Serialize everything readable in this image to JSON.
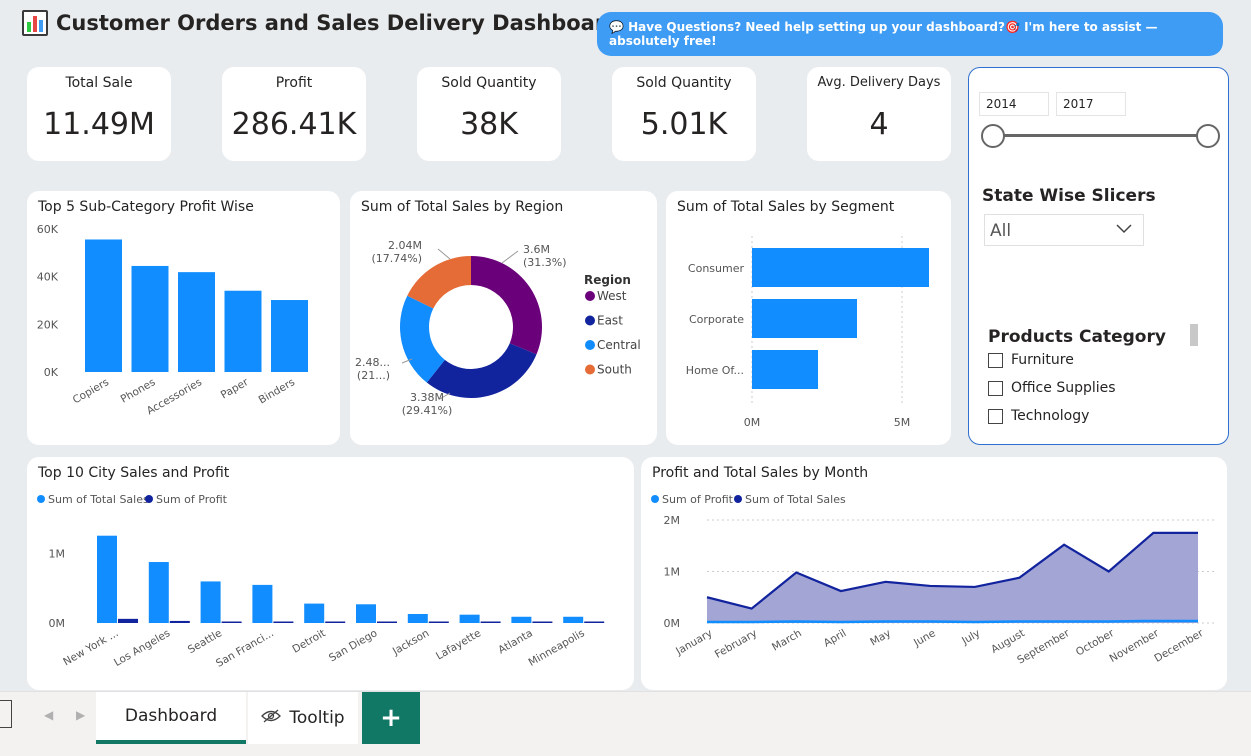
{
  "header": {
    "title": "Customer Orders and Sales Delivery Dashboard",
    "help_text": "💬 Have Questions? Need help setting up your dashboard?🎯 I'm here to assist — absolutely free!"
  },
  "kpis": [
    {
      "label": "Total Sale",
      "value": "11.49M"
    },
    {
      "label": "Profit",
      "value": "286.41K"
    },
    {
      "label": "Sold Quantity",
      "value": "38K"
    },
    {
      "label": "Sold Quantity",
      "value": "5.01K"
    },
    {
      "label": "Avg. Delivery Days",
      "value": "4"
    }
  ],
  "filters": {
    "date_from": "2014",
    "date_to": "2017",
    "state_heading": "State Wise Slicers",
    "state_value": "All",
    "category_heading": "Products Category",
    "categories": [
      "Furniture",
      "Office Supplies",
      "Technology"
    ]
  },
  "colors": {
    "blue": "#118dff",
    "dark_blue": "#12239e",
    "purple": "#6b007b",
    "orange": "#e66c37",
    "area_fill": "#a3a6d4"
  },
  "chart_data": [
    {
      "id": "subcat",
      "type": "bar",
      "title": "Top 5 Sub-Category Profit Wise",
      "categories": [
        "Copiers",
        "Phones",
        "Accessories",
        "Paper",
        "Binders"
      ],
      "values": [
        55600,
        44500,
        41900,
        34100,
        30200
      ],
      "yticks": [
        "0K",
        "20K",
        "40K",
        "60K"
      ],
      "ylim": [
        0,
        60000
      ]
    },
    {
      "id": "region",
      "type": "pie",
      "title": "Sum of Total Sales by Region",
      "legend_title": "Region",
      "slices": [
        {
          "name": "West",
          "value": 3.6,
          "label": "3.6M",
          "pct": "(31.3%)",
          "color": "#6b007b"
        },
        {
          "name": "East",
          "value": 3.38,
          "label": "3.38M",
          "pct": "(29.41%)",
          "color": "#12239e"
        },
        {
          "name": "Central",
          "value": 2.48,
          "label": "2.48...",
          "pct": "(21...)",
          "color": "#118dff"
        },
        {
          "name": "South",
          "value": 2.04,
          "label": "2.04M",
          "pct": "(17.74%)",
          "color": "#e66c37"
        }
      ]
    },
    {
      "id": "segment",
      "type": "bar",
      "orientation": "horizontal",
      "title": "Sum of Total Sales by Segment",
      "categories": [
        "Consumer",
        "Corporate",
        "Home Of..."
      ],
      "values": [
        5.9,
        3.5,
        2.2
      ],
      "xticks": [
        "0M",
        "5M"
      ],
      "xlim": [
        0,
        5
      ]
    },
    {
      "id": "city",
      "type": "bar",
      "title": "Top 10 City Sales and Profit",
      "categories": [
        "New York ...",
        "Los Angeles",
        "Seattle",
        "San Franci...",
        "Detroit",
        "San Diego",
        "Jackson",
        "Lafayette",
        "Atlanta",
        "Minneapolis"
      ],
      "series": [
        {
          "name": "Sum of Total Sales",
          "values": [
            1.26,
            0.88,
            0.6,
            0.55,
            0.28,
            0.27,
            0.13,
            0.12,
            0.09,
            0.09
          ],
          "color": "#118dff"
        },
        {
          "name": "Sum of Profit",
          "values": [
            0.06,
            0.03,
            0.02,
            0.01,
            0.01,
            0.01,
            0.005,
            0.005,
            0.005,
            0.005
          ],
          "color": "#12239e"
        }
      ],
      "yticks": [
        "0M",
        "1M"
      ],
      "ylim": [
        0,
        1.4
      ]
    },
    {
      "id": "month",
      "type": "area",
      "title": "Profit and Total Sales by Month",
      "categories": [
        "January",
        "February",
        "March",
        "April",
        "May",
        "June",
        "July",
        "August",
        "September",
        "October",
        "November",
        "December"
      ],
      "series": [
        {
          "name": "Sum of Profit",
          "values": [
            0.02,
            0.02,
            0.03,
            0.02,
            0.03,
            0.03,
            0.02,
            0.03,
            0.03,
            0.03,
            0.04,
            0.04
          ],
          "color": "#118dff"
        },
        {
          "name": "Sum of Total Sales",
          "values": [
            0.5,
            0.28,
            0.98,
            0.62,
            0.8,
            0.72,
            0.7,
            0.88,
            1.52,
            1.0,
            1.75,
            1.75
          ],
          "color": "#12239e"
        }
      ],
      "yticks": [
        "0M",
        "1M",
        "2M"
      ],
      "ylim": [
        0,
        2
      ]
    }
  ],
  "tabs": {
    "dashboard": "Dashboard",
    "tooltip": "Tooltip",
    "add": "+"
  }
}
